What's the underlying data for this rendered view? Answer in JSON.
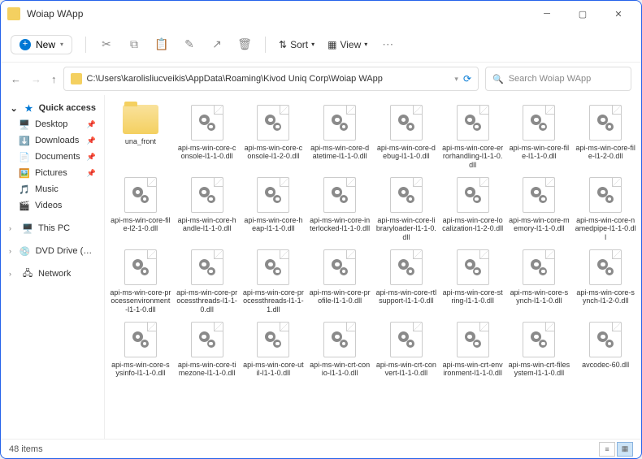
{
  "title": "Woiap WApp",
  "toolbar": {
    "new": "New",
    "sort": "Sort",
    "view": "View"
  },
  "path": "C:\\Users\\karolisliucveikis\\AppData\\Roaming\\Kivod Uniq Corp\\Woiap WApp",
  "search_placeholder": "Search Woiap WApp",
  "sidebar": {
    "quick_access": "Quick access",
    "items": [
      {
        "icon": "🖥️",
        "label": "Desktop",
        "pin": true
      },
      {
        "icon": "⬇️",
        "label": "Downloads",
        "pin": true
      },
      {
        "icon": "📄",
        "label": "Documents",
        "pin": true
      },
      {
        "icon": "🖼️",
        "label": "Pictures",
        "pin": true
      },
      {
        "icon": "🎵",
        "label": "Music",
        "pin": false
      },
      {
        "icon": "🎬",
        "label": "Videos",
        "pin": false
      }
    ],
    "this_pc": "This PC",
    "dvd": "DVD Drive (D:) CCCC",
    "network": "Network"
  },
  "files": [
    {
      "type": "folder",
      "name": "una_front"
    },
    {
      "type": "dll",
      "name": "api-ms-win-core-console-l1-1-0.dll"
    },
    {
      "type": "dll",
      "name": "api-ms-win-core-console-l1-2-0.dll"
    },
    {
      "type": "dll",
      "name": "api-ms-win-core-datetime-l1-1-0.dll"
    },
    {
      "type": "dll",
      "name": "api-ms-win-core-debug-l1-1-0.dll"
    },
    {
      "type": "dll",
      "name": "api-ms-win-core-errorhandling-l1-1-0.dll"
    },
    {
      "type": "dll",
      "name": "api-ms-win-core-file-l1-1-0.dll"
    },
    {
      "type": "dll",
      "name": "api-ms-win-core-file-l1-2-0.dll"
    },
    {
      "type": "dll",
      "name": "api-ms-win-core-file-l2-1-0.dll"
    },
    {
      "type": "dll",
      "name": "api-ms-win-core-handle-l1-1-0.dll"
    },
    {
      "type": "dll",
      "name": "api-ms-win-core-heap-l1-1-0.dll"
    },
    {
      "type": "dll",
      "name": "api-ms-win-core-interlocked-l1-1-0.dll"
    },
    {
      "type": "dll",
      "name": "api-ms-win-core-libraryloader-l1-1-0.dll"
    },
    {
      "type": "dll",
      "name": "api-ms-win-core-localization-l1-2-0.dll"
    },
    {
      "type": "dll",
      "name": "api-ms-win-core-memory-l1-1-0.dll"
    },
    {
      "type": "dll",
      "name": "api-ms-win-core-namedpipe-l1-1-0.dll"
    },
    {
      "type": "dll",
      "name": "api-ms-win-core-processenvironment-l1-1-0.dll"
    },
    {
      "type": "dll",
      "name": "api-ms-win-core-processthreads-l1-1-0.dll"
    },
    {
      "type": "dll",
      "name": "api-ms-win-core-processthreads-l1-1-1.dll"
    },
    {
      "type": "dll",
      "name": "api-ms-win-core-profile-l1-1-0.dll"
    },
    {
      "type": "dll",
      "name": "api-ms-win-core-rtlsupport-l1-1-0.dll"
    },
    {
      "type": "dll",
      "name": "api-ms-win-core-string-l1-1-0.dll"
    },
    {
      "type": "dll",
      "name": "api-ms-win-core-synch-l1-1-0.dll"
    },
    {
      "type": "dll",
      "name": "api-ms-win-core-synch-l1-2-0.dll"
    },
    {
      "type": "dll",
      "name": "api-ms-win-core-sysinfo-l1-1-0.dll"
    },
    {
      "type": "dll",
      "name": "api-ms-win-core-timezone-l1-1-0.dll"
    },
    {
      "type": "dll",
      "name": "api-ms-win-core-util-l1-1-0.dll"
    },
    {
      "type": "dll",
      "name": "api-ms-win-crt-conio-l1-1-0.dll"
    },
    {
      "type": "dll",
      "name": "api-ms-win-crt-convert-l1-1-0.dll"
    },
    {
      "type": "dll",
      "name": "api-ms-win-crt-environment-l1-1-0.dll"
    },
    {
      "type": "dll",
      "name": "api-ms-win-crt-filesystem-l1-1-0.dll"
    },
    {
      "type": "dll",
      "name": "avcodec-60.dll"
    }
  ],
  "status": "48 items"
}
